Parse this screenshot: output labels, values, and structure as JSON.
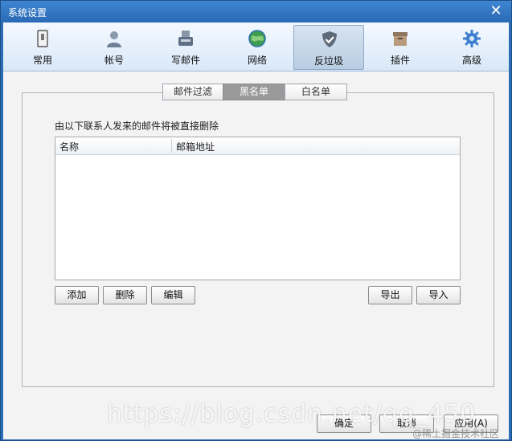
{
  "window": {
    "title": "系统设置"
  },
  "toolbar": {
    "items": [
      {
        "label": "常用",
        "icon": "general-icon"
      },
      {
        "label": "帐号",
        "icon": "account-icon"
      },
      {
        "label": "写邮件",
        "icon": "compose-icon"
      },
      {
        "label": "网络",
        "icon": "network-icon"
      },
      {
        "label": "反垃圾",
        "icon": "antispam-shield-icon",
        "active": true
      },
      {
        "label": "插件",
        "icon": "plugin-box-icon"
      },
      {
        "label": "高级",
        "icon": "gear-icon"
      }
    ]
  },
  "tabs": [
    {
      "label": "邮件过滤"
    },
    {
      "label": "黑名单",
      "active": true
    },
    {
      "label": "白名单"
    }
  ],
  "blacklist": {
    "description": "由以下联系人发来的邮件将被直接删除",
    "columns": [
      "名称",
      "邮箱地址"
    ],
    "rows": []
  },
  "actions": {
    "add": "添加",
    "delete": "删除",
    "edit": "编辑",
    "export": "导出",
    "import": "导入"
  },
  "footer": {
    "ok": "确定",
    "cancel": "取消",
    "apply": "应用(A)"
  },
  "watermark": {
    "main": "https://blog.csdn.net/qq_450",
    "sub": "@稀土掘金技术社区"
  }
}
